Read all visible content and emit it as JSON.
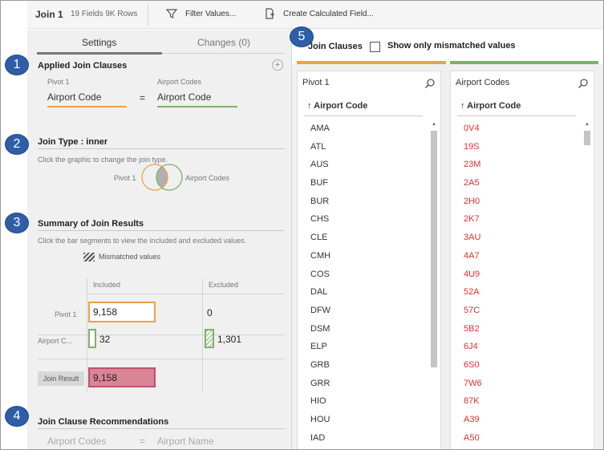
{
  "toolbar": {
    "title": "Join 1",
    "meta": "19 Fields  9K Rows",
    "filter_label": "Filter Values...",
    "calc_label": "Create Calculated Field..."
  },
  "tabs": {
    "settings": "Settings",
    "changes": "Changes (0)"
  },
  "badges": [
    "1",
    "2",
    "3",
    "4",
    "5"
  ],
  "applied": {
    "title": "Applied Join Clauses",
    "left_source": "Pivot 1",
    "right_source": "Airport Codes",
    "left_field": "Airport Code",
    "operator": "=",
    "right_field": "Airport Code"
  },
  "join_type": {
    "title": "Join Type : inner",
    "hint": "Click the graphic to change the join type.",
    "left_label": "Pivot 1",
    "right_label": "Airport Codes"
  },
  "summary": {
    "title": "Summary of Join Results",
    "hint": "Click the bar segments to view the included and excluded values.",
    "legend": "Mismatched values",
    "included_header": "Included",
    "excluded_header": "Excluded",
    "row1_label": "Pivot 1",
    "row1_included": "9,158",
    "row1_excluded": "0",
    "row2_label": "Airport C...",
    "row2_included": "32",
    "row2_excluded": "1,301",
    "result_label": "Join Result",
    "result_value": "9,158"
  },
  "recommendations": {
    "title": "Join Clause Recommendations",
    "left": "Airport Codes",
    "operator": "=",
    "right": "Airport Name"
  },
  "join_clauses": {
    "title": "Join Clauses",
    "checkbox_label": "Show only mismatched values",
    "checked": false,
    "left_color": "#f0a044",
    "right_color": "#7fb069",
    "mismatch_color": "#e03030"
  },
  "left_column": {
    "source": "Pivot 1",
    "field": "Airport Code",
    "values": [
      "AMA",
      "ATL",
      "AUS",
      "BUF",
      "BUR",
      "CHS",
      "CLE",
      "CMH",
      "COS",
      "DAL",
      "DFW",
      "DSM",
      "ELP",
      "GRB",
      "GRR",
      "HIO",
      "HOU",
      "IAD"
    ]
  },
  "right_column": {
    "source": "Airport Codes",
    "field": "Airport Code",
    "values": [
      "0V4",
      "19S",
      "23M",
      "2A5",
      "2H0",
      "2K7",
      "3AU",
      "4A7",
      "4U9",
      "52A",
      "57C",
      "5B2",
      "6J4",
      "6S0",
      "7W6",
      "87K",
      "A39",
      "A50"
    ]
  },
  "icons": {
    "filter": "filter-icon",
    "calc": "calculated-field-icon",
    "plus": "plus-icon",
    "venn": "venn-diagram-icon",
    "hatch": "hatch-pattern-icon",
    "search": "search-icon",
    "sort": "sort-arrow-icon"
  }
}
